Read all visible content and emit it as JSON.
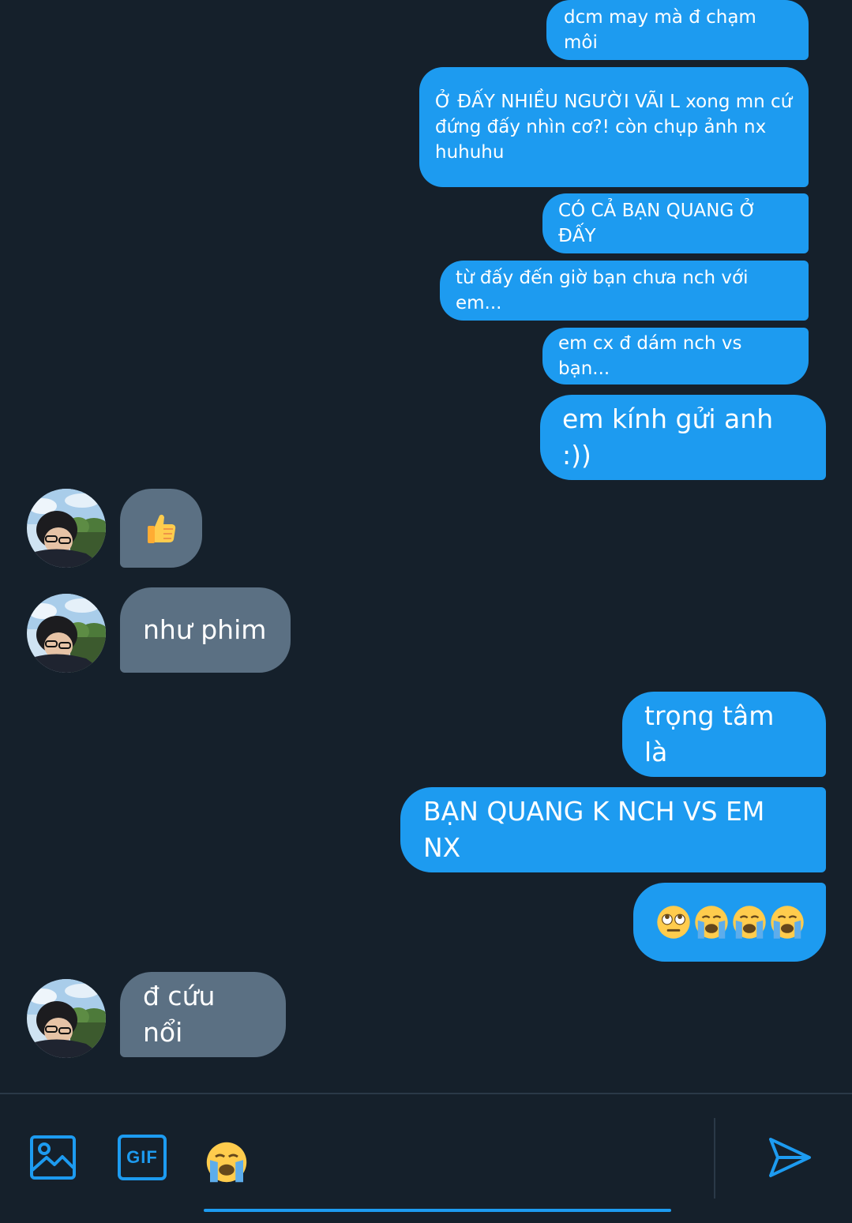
{
  "messages": [
    {
      "dir": "out",
      "text": "dcm may mà đ chạm môi"
    },
    {
      "dir": "out",
      "text": "Ở ĐẤY NHIỀU NGƯỜI VÃI L xong mn cứ đứng đấy nhìn cơ?! còn chụp ảnh nx huhuhu"
    },
    {
      "dir": "out",
      "text": "CÓ CẢ BẠN QUANG Ở ĐẤY"
    },
    {
      "dir": "out",
      "text": "từ đấy đến giờ bạn chưa nch với em..."
    },
    {
      "dir": "out",
      "text": "em cx đ dám nch vs bạn..."
    },
    {
      "dir": "out",
      "text": "em kính gửi anh :))"
    },
    {
      "dir": "in",
      "emoji": "thumbs-up"
    },
    {
      "dir": "in",
      "text": "như phim"
    },
    {
      "dir": "out",
      "text": "trọng tâm là"
    },
    {
      "dir": "out",
      "text": "BẠN QUANG K NCH VS EM NX"
    },
    {
      "dir": "out",
      "emojis": [
        "face-with-rolling-eyes",
        "loudly-crying-face",
        "loudly-crying-face",
        "loudly-crying-face"
      ]
    },
    {
      "dir": "in",
      "text": "đ cứu nổi"
    }
  ],
  "composer": {
    "gif_label": "GIF",
    "icons": [
      "image-icon",
      "gif-icon",
      "loudly-crying-face-emoji",
      "send-icon"
    ]
  },
  "colors": {
    "background": "#15202b",
    "outgoing_bubble": "#1d9bf0",
    "incoming_bubble": "#5b7083",
    "accent": "#1d9bf0"
  }
}
